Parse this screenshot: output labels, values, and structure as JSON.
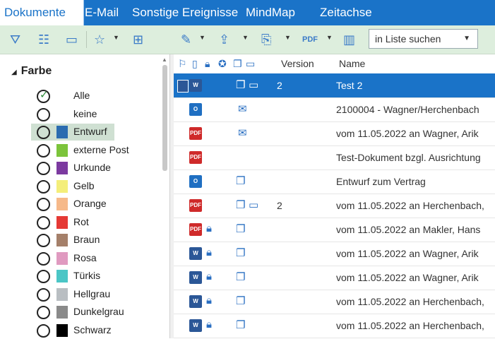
{
  "tabs": [
    "Dokumente",
    "E-Mail",
    "Sonstige Ereignisse",
    "MindMap",
    "Zeitachse"
  ],
  "toolbar": {
    "icons_left": [
      "filter-icon",
      "hierarchy-icon",
      "folder-icon",
      "star-icon",
      "add-box-icon"
    ],
    "icons_right": [
      "edit-icon",
      "export-icon",
      "copy-doc-icon",
      "pdf-icon",
      "columns-icon"
    ],
    "pdf_label": "PDF",
    "search_value": "in Liste suchen"
  },
  "filter": {
    "group_label": "Farbe",
    "items": [
      {
        "label": "Alle",
        "color": "",
        "checked": true
      },
      {
        "label": "keine",
        "color": ""
      },
      {
        "label": "Entwurf",
        "color": "#2b6cb0",
        "selected": true
      },
      {
        "label": "externe Post",
        "color": "#7cc43b"
      },
      {
        "label": "Urkunde",
        "color": "#7c3aa0"
      },
      {
        "label": "Gelb",
        "color": "#f4ee7a"
      },
      {
        "label": "Orange",
        "color": "#f6b98a"
      },
      {
        "label": "Rot",
        "color": "#e53935"
      },
      {
        "label": "Braun",
        "color": "#a5806a"
      },
      {
        "label": "Rosa",
        "color": "#e09ac0"
      },
      {
        "label": "Türkis",
        "color": "#4bc6c6"
      },
      {
        "label": "Hellgrau",
        "color": "#b9bec2"
      },
      {
        "label": "Dunkelgrau",
        "color": "#8a8a8a"
      },
      {
        "label": "Schwarz",
        "color": "#000000"
      }
    ]
  },
  "table": {
    "headers": {
      "version": "Version",
      "name": "Name"
    },
    "rows": [
      {
        "type": "word",
        "lock": false,
        "mail": false,
        "copies": "2",
        "version": "2",
        "name": "Test 2",
        "selected": true
      },
      {
        "type": "outlook",
        "lock": false,
        "mail": true,
        "copies": "",
        "version": "",
        "name": "2100004 - Wagner/Herchenbach"
      },
      {
        "type": "pdf",
        "lock": false,
        "mail": true,
        "copies": "",
        "version": "",
        "name": "vom 11.05.2022 an Wagner, Arik"
      },
      {
        "type": "pdf",
        "lock": false,
        "mail": false,
        "copies": "",
        "version": "",
        "name": "Test-Dokument bzgl. Ausrichtung"
      },
      {
        "type": "outlook",
        "lock": false,
        "mail": false,
        "copies": "1",
        "version": "",
        "name": "Entwurf zum Vertrag"
      },
      {
        "type": "pdf",
        "lock": false,
        "mail": false,
        "copies": "2",
        "version": "2",
        "name": "vom 11.05.2022 an Herchenbach,"
      },
      {
        "type": "pdf",
        "lock": true,
        "mail": false,
        "copies": "1",
        "version": "",
        "name": "vom 11.05.2022 an Makler, Hans"
      },
      {
        "type": "word",
        "lock": true,
        "mail": false,
        "copies": "1",
        "version": "",
        "name": "vom 11.05.2022 an Wagner, Arik"
      },
      {
        "type": "word",
        "lock": true,
        "mail": false,
        "copies": "1",
        "version": "",
        "name": "vom 11.05.2022 an Wagner, Arik"
      },
      {
        "type": "word",
        "lock": true,
        "mail": false,
        "copies": "1",
        "version": "",
        "name": "vom 11.05.2022 an Herchenbach,"
      },
      {
        "type": "word",
        "lock": true,
        "mail": false,
        "copies": "1",
        "version": "",
        "name": "vom 11.05.2022 an Herchenbach,"
      }
    ]
  },
  "doc_badges": {
    "word": "W",
    "outlook": "O",
    "pdf": "PDF"
  }
}
